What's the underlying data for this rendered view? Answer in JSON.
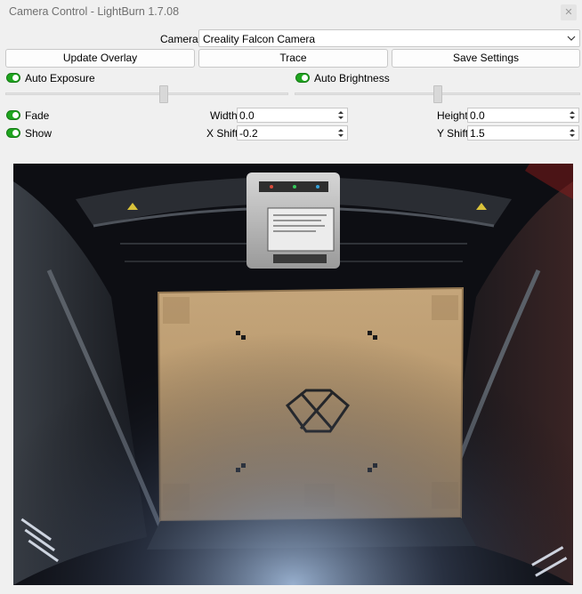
{
  "window": {
    "title": "Camera Control - LightBurn 1.7.08",
    "close_glyph": "✕"
  },
  "camera_select": {
    "label": "Camera:",
    "value": "Creality Falcon Camera"
  },
  "buttons": {
    "update_overlay": "Update Overlay",
    "trace": "Trace",
    "save_settings": "Save Settings"
  },
  "toggles": {
    "auto_exposure": {
      "label": "Auto Exposure",
      "on": true
    },
    "auto_brightness": {
      "label": "Auto Brightness",
      "on": true
    },
    "fade": {
      "label": "Fade",
      "on": true
    },
    "show": {
      "label": "Show",
      "on": true
    }
  },
  "fields": {
    "width": {
      "label": "Width",
      "value": "0.0"
    },
    "height": {
      "label": "Height",
      "value": "0.0"
    },
    "x_shift": {
      "label": "X Shift",
      "value": "-0.2"
    },
    "y_shift": {
      "label": "Y Shift",
      "value": "1.5"
    }
  },
  "colors": {
    "toggle_on": "#1fa51f",
    "cardboard": "#b8996f",
    "laser_body": "#c8c8c8"
  }
}
